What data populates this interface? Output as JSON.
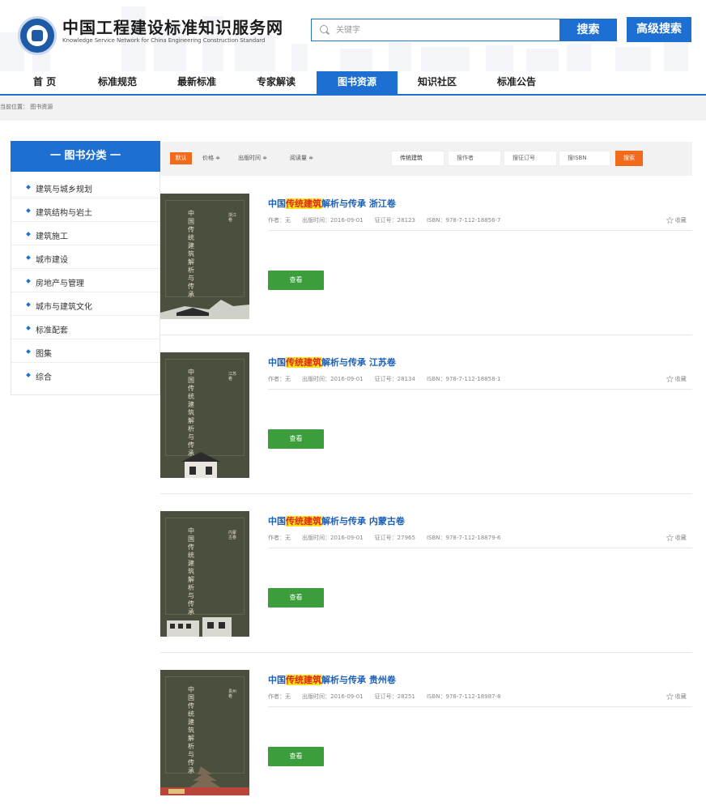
{
  "header": {
    "title": "中国工程建设标准知识服务网",
    "subtitle": "Knowledge Service Network for China Engineering Construction Standard",
    "search_placeholder": "关键字",
    "search_button": "搜索",
    "advanced_button": "高级搜索"
  },
  "nav": {
    "items": [
      {
        "label": "首 页"
      },
      {
        "label": "标准规范"
      },
      {
        "label": "最新标准"
      },
      {
        "label": "专家解读"
      },
      {
        "label": "图书资源"
      },
      {
        "label": "知识社区"
      },
      {
        "label": "标准公告"
      }
    ],
    "active": "图书资源"
  },
  "breadcrumb": "当前位置： 图书资源",
  "sidebar": {
    "heading": "一 图书分类 一",
    "items": [
      {
        "label": "建筑与城乡规划"
      },
      {
        "label": "建筑结构与岩土"
      },
      {
        "label": "建筑施工"
      },
      {
        "label": "城市建设"
      },
      {
        "label": "房地产与管理"
      },
      {
        "label": "城市与建筑文化"
      },
      {
        "label": "标准配套"
      },
      {
        "label": "图集"
      },
      {
        "label": "综合"
      }
    ]
  },
  "filter": {
    "default_label": "默认",
    "sort_price": "价格 ≑",
    "sort_date": "出版时间 ≑",
    "sort_reads": "阅读量 ≑",
    "keyword_value": "传统建筑",
    "author_placeholder": "搜作者",
    "order_placeholder": "搜征订号",
    "isbn_placeholder": "搜ISBN",
    "search_button": "搜索"
  },
  "books": [
    {
      "title_prefix": "中国",
      "title_highlight": "传统建筑",
      "title_suffix": "解析与传承 浙江卷",
      "author": "作者：无",
      "date": "出版时间：2016-09-01",
      "order": "征订号：28123",
      "isbn": "ISBN：978-7-112-18856-7",
      "fav": "收藏",
      "view": "查看",
      "cover_title": "中国传统建筑解析与传承",
      "cover_tag": "浙江卷"
    },
    {
      "title_prefix": "中国",
      "title_highlight": "传统建筑",
      "title_suffix": "解析与传承 江苏卷",
      "author": "作者：无",
      "date": "出版时间：2016-09-01",
      "order": "征订号：28134",
      "isbn": "ISBN：978-7-112-18858-1",
      "fav": "收藏",
      "view": "查看",
      "cover_title": "中国传统建筑解析与传承",
      "cover_tag": "江苏卷"
    },
    {
      "title_prefix": "中国",
      "title_highlight": "传统建筑",
      "title_suffix": "解析与传承 内蒙古卷",
      "author": "作者：无",
      "date": "出版时间：2016-09-01",
      "order": "征订号：27965",
      "isbn": "ISBN：978-7-112-18879-6",
      "fav": "收藏",
      "view": "查看",
      "cover_title": "中国传统建筑解析与传承",
      "cover_tag": "内蒙古卷"
    },
    {
      "title_prefix": "中国",
      "title_highlight": "传统建筑",
      "title_suffix": "解析与传承 贵州卷",
      "author": "作者：无",
      "date": "出版时间：2016-09-01",
      "order": "征订号：28251",
      "isbn": "ISBN：978-7-112-18987-8",
      "fav": "收藏",
      "view": "查看",
      "cover_title": "中国传统建筑解析与传承",
      "cover_tag": "贵州卷"
    }
  ],
  "colors": {
    "primary": "#1d6fd1",
    "accent": "#f26b1d",
    "view_button": "#3b9d3b",
    "highlight_bg": "#f8e31a",
    "highlight_text": "#e1251b"
  },
  "icons": {
    "search": "search-icon",
    "favorite": "star-outline-icon",
    "logo": "site-logo-icon"
  }
}
